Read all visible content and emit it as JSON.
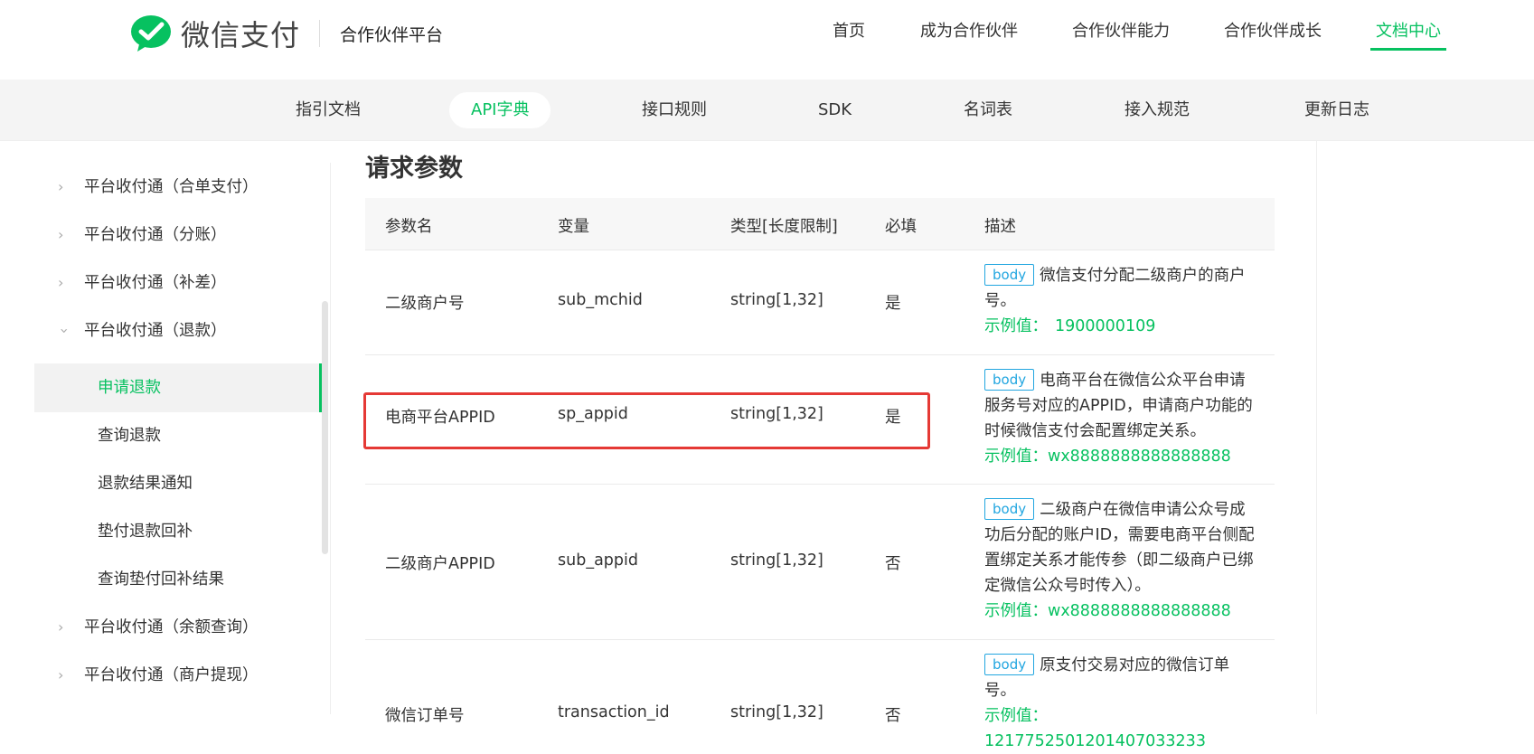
{
  "header": {
    "brand": "微信支付",
    "platform": "合作伙伴平台",
    "nav": [
      {
        "label": "首页",
        "active": false
      },
      {
        "label": "成为合作伙伴",
        "active": false
      },
      {
        "label": "合作伙伴能力",
        "active": false
      },
      {
        "label": "合作伙伴成长",
        "active": false
      },
      {
        "label": "文档中心",
        "active": true
      }
    ]
  },
  "subnav": [
    {
      "label": "指引文档",
      "active": false
    },
    {
      "label": "API字典",
      "active": true
    },
    {
      "label": "接口规则",
      "active": false
    },
    {
      "label": "SDK",
      "active": false
    },
    {
      "label": "名词表",
      "active": false
    },
    {
      "label": "接入规范",
      "active": false
    },
    {
      "label": "更新日志",
      "active": false
    }
  ],
  "sidebar": {
    "items": [
      {
        "label": "平台收付通（合单支付）",
        "type": "group",
        "expanded": false
      },
      {
        "label": "平台收付通（分账）",
        "type": "group",
        "expanded": false
      },
      {
        "label": "平台收付通（补差）",
        "type": "group",
        "expanded": false
      },
      {
        "label": "平台收付通（退款）",
        "type": "group",
        "expanded": true
      },
      {
        "label": "申请退款",
        "type": "child",
        "active": true
      },
      {
        "label": "查询退款",
        "type": "child"
      },
      {
        "label": "退款结果通知",
        "type": "child"
      },
      {
        "label": "垫付退款回补",
        "type": "child"
      },
      {
        "label": "查询垫付回补结果",
        "type": "child"
      },
      {
        "label": "平台收付通（余额查询）",
        "type": "group",
        "expanded": false
      },
      {
        "label": "平台收付通（商户提现）",
        "type": "group",
        "expanded": false
      }
    ]
  },
  "main": {
    "section_title": "请求参数",
    "table": {
      "headers": [
        "参数名",
        "变量",
        "类型[长度限制]",
        "必填",
        "描述"
      ],
      "rows": [
        {
          "name": "二级商户号",
          "variable": "sub_mchid",
          "type": "string[1,32]",
          "required": "是",
          "tag": "body",
          "desc": "微信支付分配二级商户的商户号。",
          "example_label": "示例值：",
          "example_value": "1900000109"
        },
        {
          "name": "电商平台APPID",
          "variable": "sp_appid",
          "type": "string[1,32]",
          "required": "是",
          "tag": "body",
          "desc": "电商平台在微信公众平台申请服务号对应的APPID，申请商户功能的时候微信支付会配置绑定关系。",
          "example_label": "示例值：",
          "example_value": "wx8888888888888888"
        },
        {
          "name": "二级商户APPID",
          "variable": "sub_appid",
          "type": "string[1,32]",
          "required": "否",
          "tag": "body",
          "desc": "二级商户在微信申请公众号成功后分配的账户ID，需要电商平台侧配置绑定关系才能传参（即二级商户已绑定微信公众号时传入）。",
          "example_label": "示例值：",
          "example_value": "wx8888888888888888"
        },
        {
          "name": "微信订单号",
          "variable": "transaction_id",
          "type": "string[1,32]",
          "required": "否",
          "tag": "body",
          "desc": "原支付交易对应的微信订单号。",
          "example_label": "示例值：",
          "example_value": "1217752501201407033233"
        }
      ]
    }
  },
  "colors": {
    "accent": "#07c160",
    "tag": "#22a6e0",
    "highlight": "#e53935"
  }
}
